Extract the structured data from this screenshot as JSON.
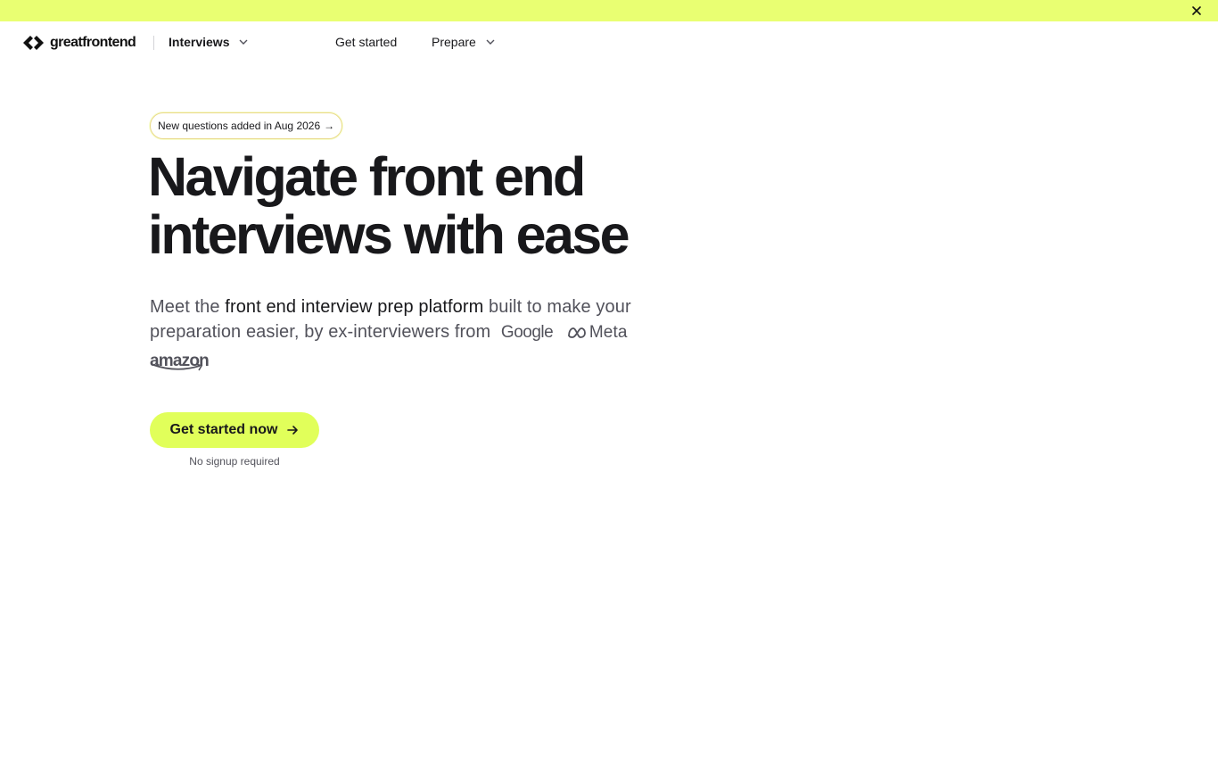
{
  "banner": {
    "close_icon": "close-icon",
    "color": "#e9ff72"
  },
  "nav": {
    "logo_text": "greatfrontend",
    "product_switcher": "Interviews",
    "links": [
      {
        "label": "Get started"
      },
      {
        "label": "Prepare"
      }
    ]
  },
  "hero": {
    "badge": "New questions added in Aug 2026",
    "badge_arrow": "→",
    "headline_line1": "Navigate front end",
    "headline_line2": "interviews with ease",
    "sub_part1": "Meet the ",
    "sub_highlight": "front end interview prep platform",
    "sub_part2": " built to make your preparation easier, by ex-interviewers from",
    "companies": [
      "Google",
      "Meta",
      "amazon"
    ],
    "cta_label": "Get started now",
    "cta_note": "No signup required",
    "accent_color": "#e1ff5a"
  }
}
